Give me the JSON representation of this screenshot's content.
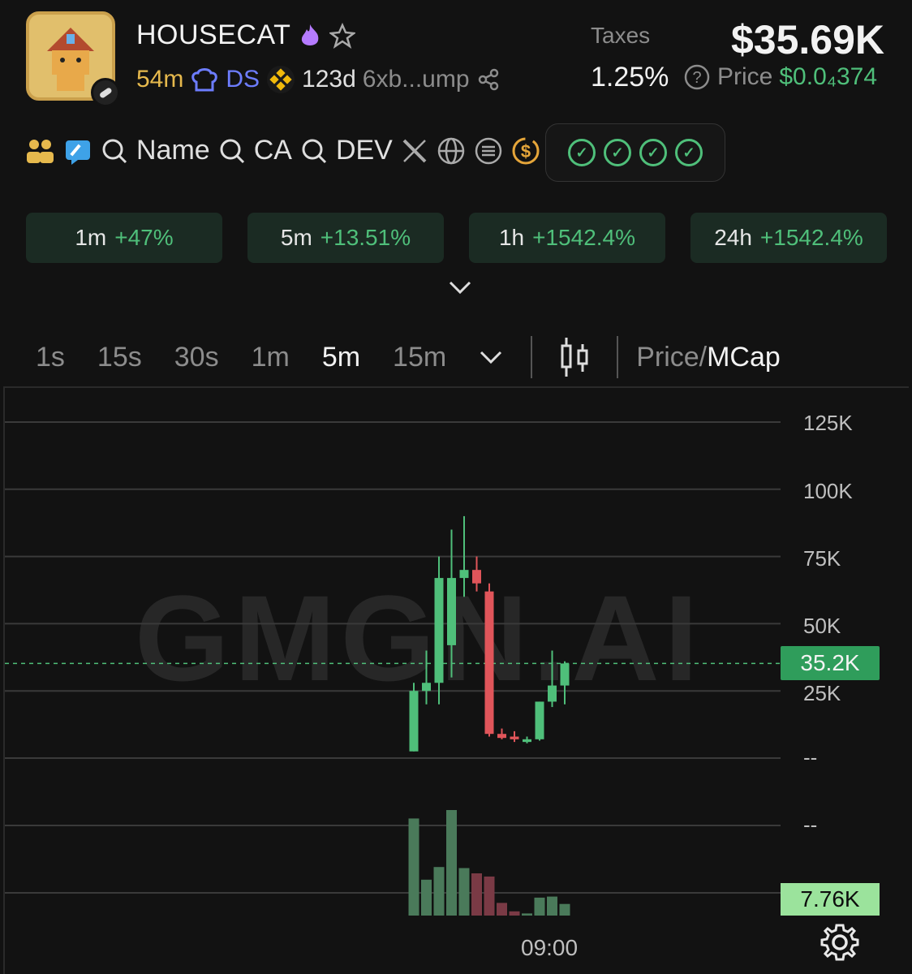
{
  "token": {
    "name": "HOUSECAT",
    "age": "54m",
    "ds_label": "DS",
    "chain_age": "123d",
    "contract": "6xb...ump"
  },
  "stats": {
    "taxes_label": "Taxes",
    "taxes_value": "1.25%",
    "market_cap": "$35.69K",
    "price_label": "Price",
    "price_value": "$0.0₄374"
  },
  "tools": {
    "name_label": "Name",
    "ca_label": "CA",
    "dev_label": "DEV"
  },
  "changes": [
    {
      "period": "1m",
      "value": "+47%"
    },
    {
      "period": "5m",
      "value": "+13.51%"
    },
    {
      "period": "1h",
      "value": "+1542.4%"
    },
    {
      "period": "24h",
      "value": "+1542.4%"
    }
  ],
  "timeframes": [
    "1s",
    "15s",
    "30s",
    "1m",
    "5m",
    "15m"
  ],
  "active_timeframe": "5m",
  "price_toggle": {
    "price": "Price/",
    "mcap": "MCap"
  },
  "chart": {
    "watermark": "GMGN.AI",
    "y_ticks": [
      "125K",
      "100K",
      "75K",
      "50K",
      "25K",
      "--"
    ],
    "volume_tick": "--",
    "current_value": "35.2K",
    "volume_value": "7.76K",
    "time_label": "09:00"
  },
  "chart_data": {
    "type": "candlestick",
    "ylim": [
      0,
      125000
    ],
    "y_ticks": [
      125000,
      100000,
      75000,
      50000,
      25000
    ],
    "current_line": 35200,
    "candles": [
      {
        "o": 2500,
        "h": 28000,
        "l": 2500,
        "c": 25000
      },
      {
        "o": 25000,
        "h": 40000,
        "l": 20000,
        "c": 28000
      },
      {
        "o": 28000,
        "h": 75000,
        "l": 20000,
        "c": 67000
      },
      {
        "o": 42000,
        "h": 85000,
        "l": 30000,
        "c": 67000
      },
      {
        "o": 67000,
        "h": 90000,
        "l": 60000,
        "c": 70000
      },
      {
        "o": 70000,
        "h": 75000,
        "l": 62000,
        "c": 65000
      },
      {
        "o": 62000,
        "h": 65000,
        "l": 8000,
        "c": 9000
      },
      {
        "o": 9000,
        "h": 11000,
        "l": 7000,
        "c": 7500
      },
      {
        "o": 8000,
        "h": 10000,
        "l": 6000,
        "c": 7000
      },
      {
        "o": 6000,
        "h": 8000,
        "l": 5500,
        "c": 7000
      },
      {
        "o": 7000,
        "h": 21000,
        "l": 6500,
        "c": 21000
      },
      {
        "o": 21000,
        "h": 40000,
        "l": 19000,
        "c": 27000
      },
      {
        "o": 27000,
        "h": 36000,
        "l": 20000,
        "c": 35200
      }
    ],
    "volume": [
      0.92,
      0.34,
      0.46,
      1.0,
      0.45,
      0.4,
      0.37,
      0.12,
      0.04,
      0.02,
      0.17,
      0.18,
      0.11
    ]
  }
}
